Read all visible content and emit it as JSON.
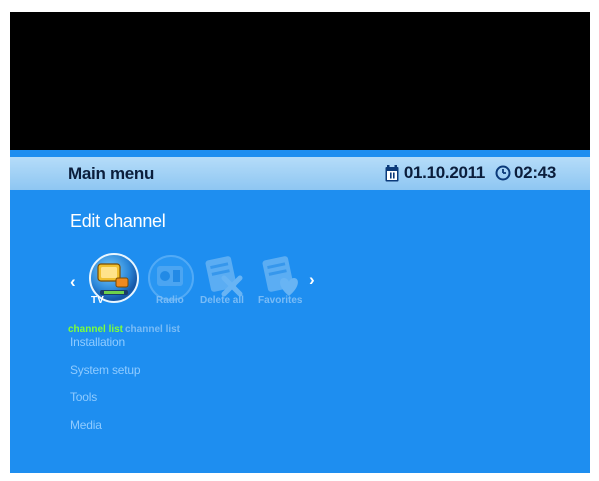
{
  "header": {
    "title": "Main menu",
    "date": "01.10.2011",
    "time": "02:43"
  },
  "section_title": "Edit channel",
  "nav": {
    "prev": "‹",
    "next": "›"
  },
  "items": [
    {
      "label": "TV",
      "sub": "channel list",
      "icon": "tv-icon",
      "selected": true
    },
    {
      "label": "Radio",
      "sub": "channel list",
      "icon": "radio-icon",
      "selected": false
    },
    {
      "label": "Delete all",
      "icon": "delete-all-icon",
      "selected": false
    },
    {
      "label": "Favorites",
      "icon": "favorites-icon",
      "selected": false
    }
  ],
  "menu": [
    "Installation",
    "System setup",
    "Tools",
    "Media"
  ],
  "colors": {
    "background": "#1e8ef0",
    "header_bar": "#a5d3f7",
    "selected_sub_label": "#7dff3a",
    "inactive_text": "#8fcbff"
  }
}
